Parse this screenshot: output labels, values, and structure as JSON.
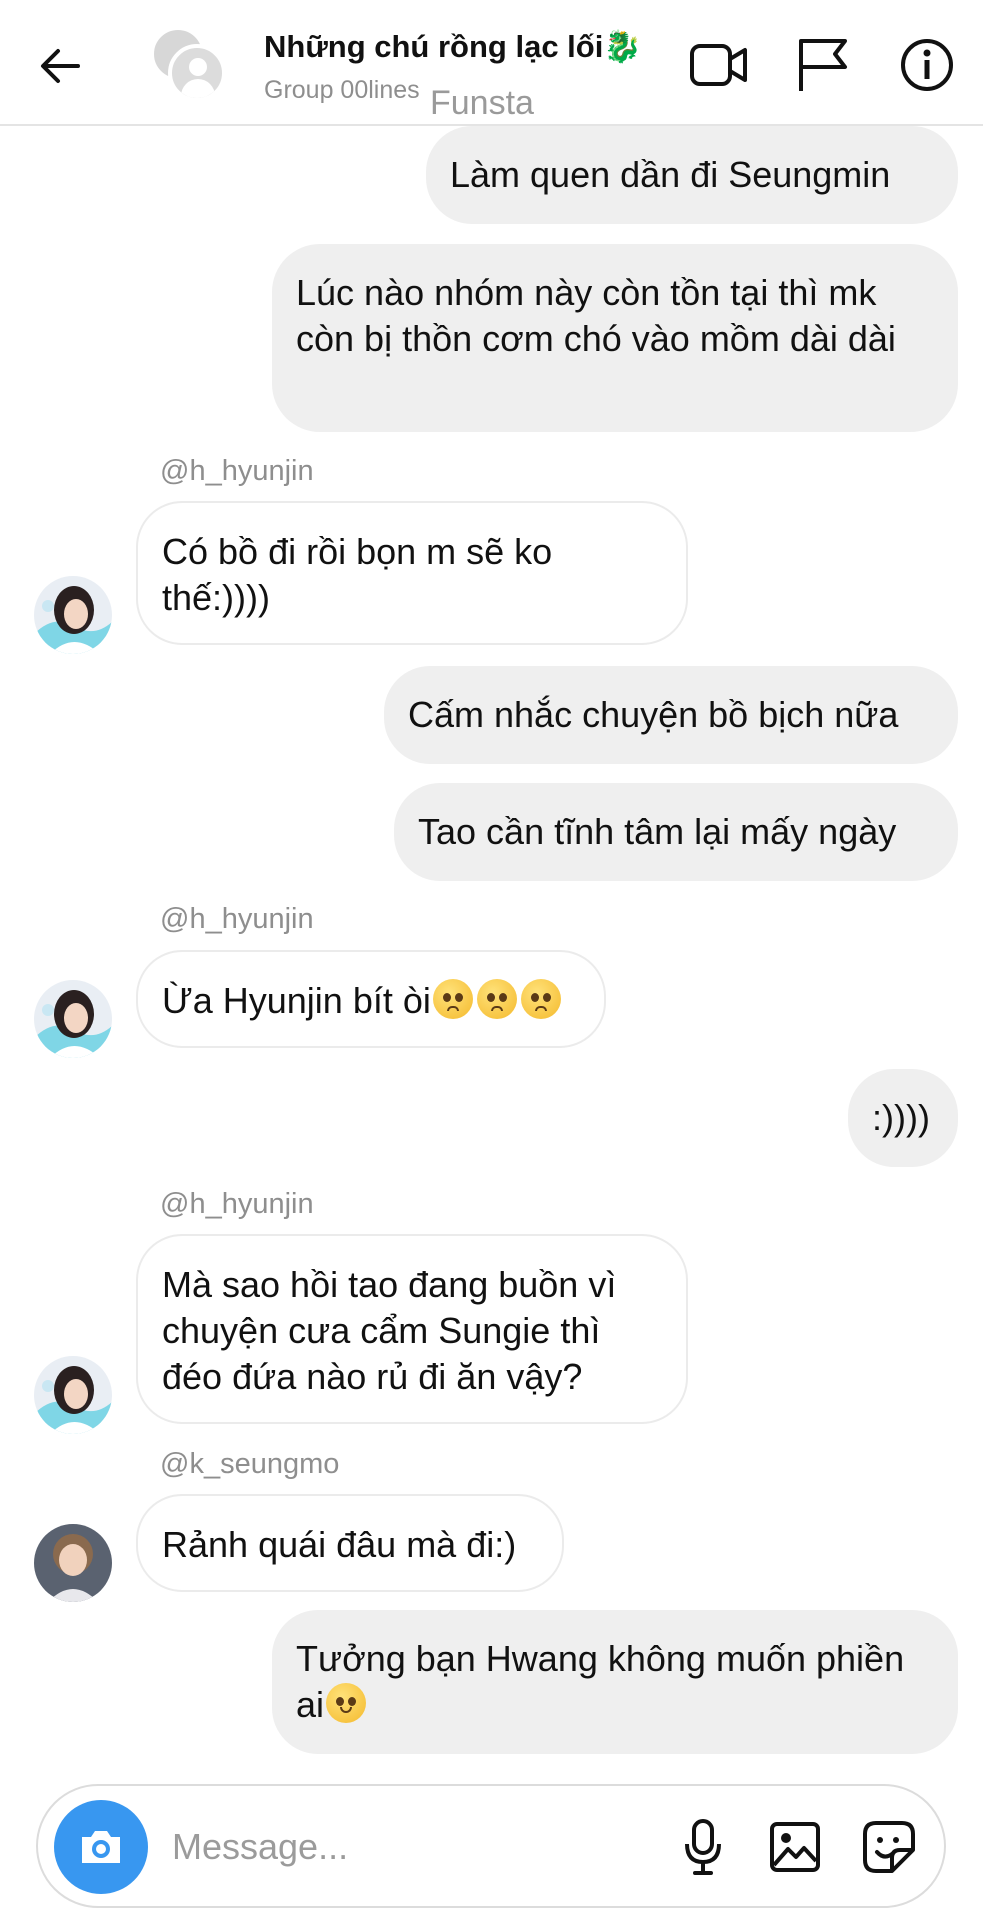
{
  "header": {
    "title": "Những chú rồng lạc lối🐉",
    "subtitle": "Group 00lines",
    "watermark": "Funsta"
  },
  "messages": [
    {
      "direction": "out",
      "text": "Làm quen dần đi Seungmin"
    },
    {
      "direction": "out",
      "text": "Lúc nào nhóm này còn tồn tại thì mk còn bị thồn cơm chó vào mồm dài dài"
    },
    {
      "direction": "in",
      "sender": "@h_hyunjin",
      "text": "Có bồ đi rồi bọn m sẽ ko thế:))))"
    },
    {
      "direction": "out",
      "text": "Cấm nhắc chuyện bồ bịch nữa"
    },
    {
      "direction": "out",
      "text": "Tao cần tĩnh tâm lại mấy ngày"
    },
    {
      "direction": "in",
      "sender": "@h_hyunjin",
      "text": "Ừa Hyunjin bít òi",
      "emojis": "🥺🥺🥺"
    },
    {
      "direction": "out",
      "text": ":))))"
    },
    {
      "direction": "in",
      "sender": "@h_hyunjin",
      "text": "Mà sao hồi tao đang buồn vì chuyện cưa cẩm Sungie thì đéo đứa nào rủ đi ăn vậy?"
    },
    {
      "direction": "in",
      "sender": "@k_seungmo",
      "text": "Rảnh quái đâu mà đi:)"
    },
    {
      "direction": "out",
      "text": "Tưởng bạn Hwang không muốn phiền ai",
      "emojis": "🙂"
    }
  ],
  "composer": {
    "placeholder": "Message..."
  },
  "colors": {
    "outgoing_bubble": "#efefef",
    "incoming_border": "#ebebeb",
    "camera_button": "#3897f0",
    "muted_text": "#8e8e8e"
  },
  "icons": {
    "header": [
      "back-arrow-icon",
      "video-call-icon",
      "flag-icon",
      "info-icon"
    ],
    "composer": [
      "camera-icon",
      "microphone-icon",
      "gallery-icon",
      "sticker-icon"
    ]
  }
}
